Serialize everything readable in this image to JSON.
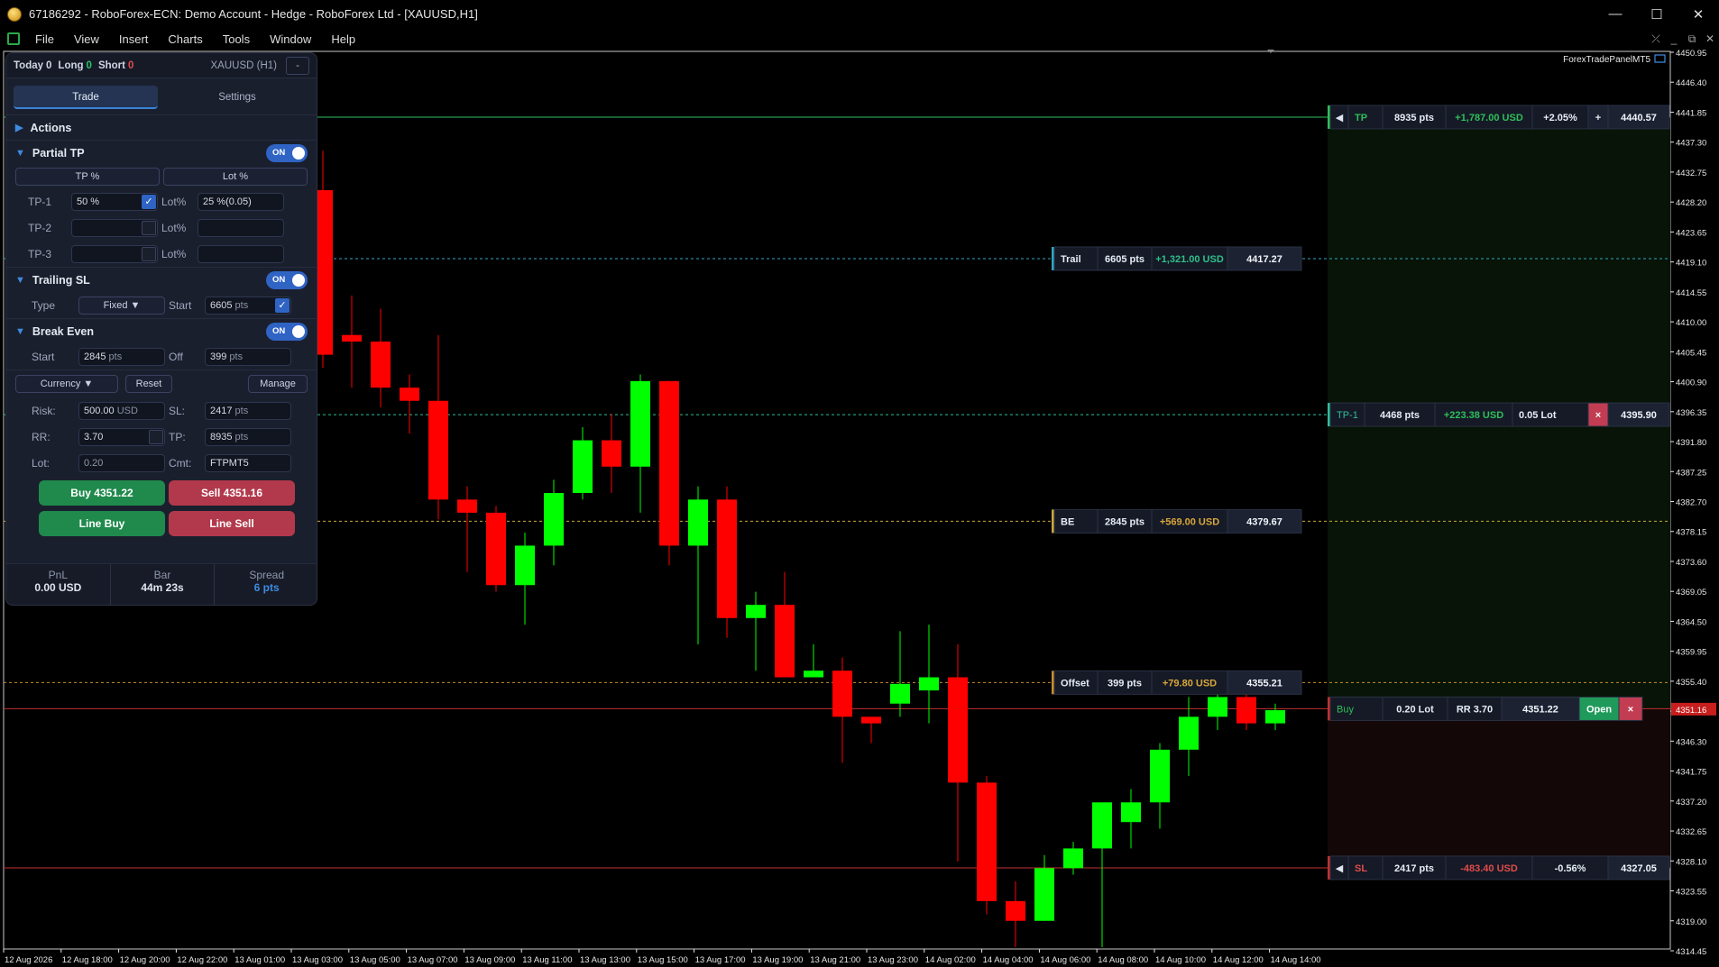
{
  "window": {
    "title": "67186292 - RoboForex-ECN: Demo Account - Hedge - RoboForex Ltd - [XAUUSD,H1]",
    "controls": [
      "—",
      "☐",
      "✕"
    ]
  },
  "menu": {
    "items": [
      "File",
      "View",
      "Insert",
      "Charts",
      "Tools",
      "Window",
      "Help"
    ],
    "mdi_controls": [
      "⤫",
      "_",
      "⧉",
      "✕"
    ]
  },
  "panel": {
    "header": {
      "today_label": "Today",
      "today_value": "0",
      "long_label": "Long",
      "long_value": "0",
      "short_label": "Short",
      "short_value": "0",
      "symbol": "XAUUSD (H1)",
      "minimize": "-"
    },
    "tabs": [
      "Trade",
      "Settings"
    ],
    "actions_label": "Actions",
    "partial_tp": {
      "label": "Partial TP",
      "toggle": "ON",
      "mode_buttons": [
        "TP %",
        "Lot %"
      ],
      "rows": [
        {
          "label": "TP-1",
          "value": "50 %",
          "lot_label": "Lot%",
          "lot_value": "25 %(0.05)"
        },
        {
          "label": "TP-2",
          "value": "",
          "lot_label": "Lot%",
          "lot_value": ""
        },
        {
          "label": "TP-3",
          "value": "",
          "lot_label": "Lot%",
          "lot_value": ""
        }
      ]
    },
    "trailing_sl": {
      "label": "Trailing SL",
      "toggle": "ON",
      "type_label": "Type",
      "type_value": "Fixed ▼",
      "start_label": "Start",
      "start_value": "6605",
      "start_unit": "pts"
    },
    "break_even": {
      "label": "Break Even",
      "toggle": "ON",
      "start_label": "Start",
      "start_value": "2845",
      "start_unit": "pts",
      "off_label": "Off",
      "off_value": "399",
      "off_unit": "pts"
    },
    "risk": {
      "currency_button": "Currency ▼",
      "reset_button": "Reset",
      "manage_button": "Manage",
      "risk_label": "Risk:",
      "risk_value": "500.00",
      "risk_unit": "USD",
      "sl_label": "SL:",
      "sl_value": "2417",
      "sl_unit": "pts",
      "rr_label": "RR:",
      "rr_value": "3.70",
      "tp_label": "TP:",
      "tp_value": "8935",
      "tp_unit": "pts",
      "lot_label": "Lot:",
      "lot_value": "0.20",
      "cmt_label": "Cmt:",
      "cmt_value": "FTPMT5"
    },
    "buttons": {
      "buy": "Buy  4351.22",
      "sell": "Sell  4351.16",
      "line_buy": "Line Buy",
      "line_sell": "Line Sell"
    },
    "footer": {
      "pnl_label": "PnL",
      "pnl_value": "0.00 USD",
      "bar_label": "Bar",
      "bar_value": "44m 23s",
      "spread_label": "Spread",
      "spread_value": "6 pts"
    }
  },
  "chart_data": {
    "type": "candlestick",
    "indicator_label": "ForexTradePanelMT5",
    "y_ticks": [
      "4450.95",
      "4446.40",
      "4441.85",
      "4437.30",
      "4432.75",
      "4428.20",
      "4423.65",
      "4419.10",
      "4414.55",
      "4410.00",
      "4405.45",
      "4400.90",
      "4396.35",
      "4391.80",
      "4387.25",
      "4382.70",
      "4378.15",
      "4373.60",
      "4369.05",
      "4364.50",
      "4359.95",
      "4355.40",
      "4350.85",
      "4346.30",
      "4341.75",
      "4337.20",
      "4332.65",
      "4328.10",
      "4323.55",
      "4319.00",
      "4314.45"
    ],
    "x_ticks": [
      "12 Aug 2026",
      "12 Aug 18:00",
      "12 Aug 20:00",
      "12 Aug 22:00",
      "13 Aug 01:00",
      "13 Aug 03:00",
      "13 Aug 05:00",
      "13 Aug 07:00",
      "13 Aug 09:00",
      "13 Aug 11:00",
      "13 Aug 13:00",
      "13 Aug 15:00",
      "13 Aug 17:00",
      "13 Aug 19:00",
      "13 Aug 21:00",
      "13 Aug 23:00",
      "14 Aug 02:00",
      "14 Aug 04:00",
      "14 Aug 06:00",
      "14 Aug 08:00",
      "14 Aug 10:00",
      "14 Aug 12:00",
      "14 Aug 14:00"
    ],
    "current_price": "4351.16",
    "candles": [
      {
        "o": 4430,
        "h": 4436,
        "l": 4403,
        "c": 4405
      },
      {
        "o": 4408,
        "h": 4414,
        "l": 4400,
        "c": 4407
      },
      {
        "o": 4407,
        "h": 4412,
        "l": 4397,
        "c": 4400
      },
      {
        "o": 4400,
        "h": 4402,
        "l": 4393,
        "c": 4398
      },
      {
        "o": 4398,
        "h": 4408,
        "l": 4380,
        "c": 4383
      },
      {
        "o": 4383,
        "h": 4385,
        "l": 4372,
        "c": 4381
      },
      {
        "o": 4381,
        "h": 4382,
        "l": 4369,
        "c": 4370
      },
      {
        "o": 4370,
        "h": 4378,
        "l": 4364,
        "c": 4376
      },
      {
        "o": 4376,
        "h": 4386,
        "l": 4373,
        "c": 4384
      },
      {
        "o": 4384,
        "h": 4394,
        "l": 4383,
        "c": 4392
      },
      {
        "o": 4392,
        "h": 4396,
        "l": 4384,
        "c": 4388
      },
      {
        "o": 4388,
        "h": 4402,
        "l": 4381,
        "c": 4401
      },
      {
        "o": 4401,
        "h": 4401,
        "l": 4373,
        "c": 4376
      },
      {
        "o": 4376,
        "h": 4385,
        "l": 4361,
        "c": 4383
      },
      {
        "o": 4383,
        "h": 4385,
        "l": 4362,
        "c": 4365
      },
      {
        "o": 4365,
        "h": 4369,
        "l": 4357,
        "c": 4367
      },
      {
        "o": 4367,
        "h": 4372,
        "l": 4356,
        "c": 4356
      },
      {
        "o": 4356,
        "h": 4361,
        "l": 4356,
        "c": 4357
      },
      {
        "o": 4357,
        "h": 4359,
        "l": 4343,
        "c": 4350
      },
      {
        "o": 4350,
        "h": 4350,
        "l": 4346,
        "c": 4349
      },
      {
        "o": 4352,
        "h": 4363,
        "l": 4350,
        "c": 4355
      },
      {
        "o": 4354,
        "h": 4364,
        "l": 4349,
        "c": 4356
      },
      {
        "o": 4356,
        "h": 4361,
        "l": 4328,
        "c": 4340
      },
      {
        "o": 4340,
        "h": 4341,
        "l": 4320,
        "c": 4322
      },
      {
        "o": 4322,
        "h": 4325,
        "l": 4315,
        "c": 4319
      },
      {
        "o": 4319,
        "h": 4329,
        "l": 4319,
        "c": 4327
      },
      {
        "o": 4327,
        "h": 4331,
        "l": 4326,
        "c": 4330
      },
      {
        "o": 4330,
        "h": 4335,
        "l": 4315,
        "c": 4337
      },
      {
        "o": 4334,
        "h": 4339,
        "l": 4330,
        "c": 4337
      },
      {
        "o": 4337,
        "h": 4346,
        "l": 4333,
        "c": 4345
      },
      {
        "o": 4345,
        "h": 4353,
        "l": 4341,
        "c": 4350
      },
      {
        "o": 4350,
        "h": 4356,
        "l": 4348,
        "c": 4353
      },
      {
        "o": 4353,
        "h": 4356,
        "l": 4348,
        "c": 4349
      },
      {
        "o": 4349,
        "h": 4352,
        "l": 4348,
        "c": 4351
      }
    ],
    "levels": [
      {
        "key": "tp",
        "price": 4441.1,
        "color": "#2fbf5a",
        "style": "solid",
        "label": "TP",
        "pts": "8935 pts",
        "money": "+1,787.00 USD",
        "pct": "+2.05%",
        "extra": "+",
        "value": "4440.57",
        "moneyColor": "#2fbf5a",
        "wide": true
      },
      {
        "key": "trail",
        "price": 4419.6,
        "color": "#2fa7c4",
        "style": "dash",
        "label": "Trail",
        "pts": "6605 pts",
        "money": "+1,321.00 USD",
        "value": "4417.27",
        "moneyColor": "#2fbf8a",
        "wide": false
      },
      {
        "key": "tp1",
        "price": 4395.9,
        "color": "#2fbf9a",
        "style": "dash",
        "label": "TP-1",
        "pts": "4468 pts",
        "money": "+223.38 USD",
        "pct": "0.05 Lot",
        "extra": "×",
        "value": "4395.90",
        "moneyColor": "#2fbf5a",
        "wide": true
      },
      {
        "key": "be",
        "price": 4379.7,
        "color": "#c9a83a",
        "style": "dash",
        "label": "BE",
        "pts": "2845 pts",
        "money": "+569.00 USD",
        "value": "4379.67",
        "moneyColor": "#d9a63b",
        "wide": false
      },
      {
        "key": "offset",
        "price": 4355.2,
        "color": "#c98c2a",
        "style": "dash",
        "label": "Offset",
        "pts": "399 pts",
        "money": "+79.80 USD",
        "value": "4355.21",
        "moneyColor": "#d9a63b",
        "wide": false
      },
      {
        "key": "buy",
        "price": 4351.22,
        "color": "#c23030",
        "style": "solid",
        "label": "Buy",
        "pts": "0.20 Lot",
        "money": "RR 3.70",
        "value": "4351.22",
        "moneyColor": "#e6ecf5",
        "wide": true,
        "open": "Open",
        "close": "×"
      },
      {
        "key": "sl",
        "price": 4327.05,
        "color": "#c23030",
        "style": "solid",
        "label": "SL",
        "pts": "2417 pts",
        "money": "-483.40 USD",
        "pct": "-0.56%",
        "value": "4327.05",
        "moneyColor": "#e04b4b",
        "wide": true
      }
    ],
    "colors": {
      "bull": "#00ff00",
      "bear": "#ff0000",
      "tp_zone": "#071407",
      "sl_zone": "#140707",
      "axis": "#e6e6e6"
    }
  }
}
